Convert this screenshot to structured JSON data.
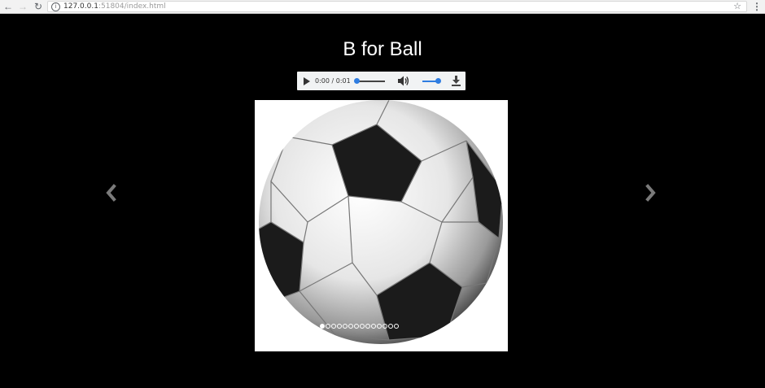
{
  "browser": {
    "back_icon": "←",
    "forward_icon": "→",
    "reload_icon": "↻",
    "info_icon": "i",
    "url_host": "127.0.0.1",
    "url_port": ":51804/",
    "url_path": "index.html",
    "star_icon": "☆",
    "menu_icon": "⋮"
  },
  "page": {
    "title": "B for Ball"
  },
  "audio": {
    "time": "0:00 / 0:01",
    "progress": 0,
    "volume": 1.0,
    "accent": "#2f7de1"
  },
  "slider": {
    "prev_icon": "chevron-left-icon",
    "next_icon": "chevron-right-icon",
    "image": "soccer-ball",
    "dot_count": 14,
    "active_index": 0
  }
}
